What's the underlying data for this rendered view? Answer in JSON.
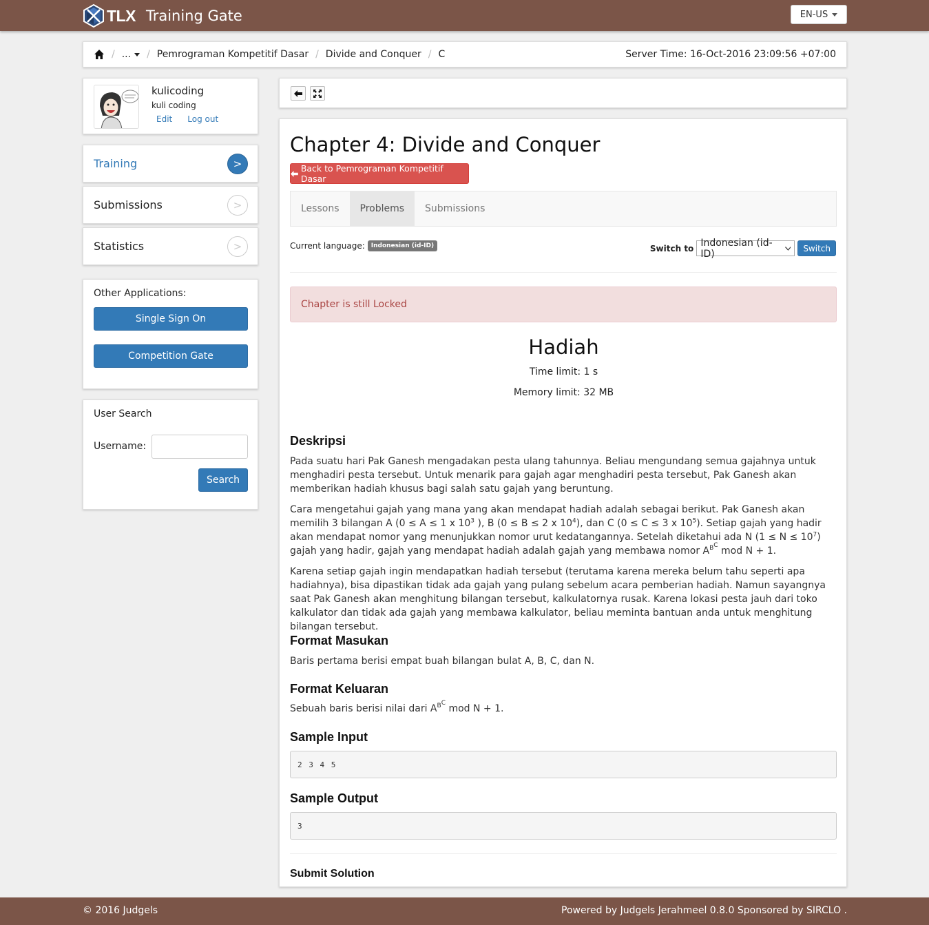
{
  "header": {
    "logo_text": "TLX",
    "app_title": "Training Gate",
    "language": "EN-US"
  },
  "breadcrumb": {
    "items": [
      "...",
      "Pemrograman Kompetitif Dasar",
      "Divide and Conquer",
      "C"
    ],
    "server_time": "Server Time: 16-Oct-2016 23:09:56 +07:00"
  },
  "profile": {
    "username": "kulicoding",
    "name": "kuli coding",
    "edit": "Edit",
    "logout": "Log out"
  },
  "menu": {
    "items": [
      {
        "label": "Training"
      },
      {
        "label": "Submissions"
      },
      {
        "label": "Statistics"
      }
    ],
    "arrow": ">"
  },
  "other_apps": {
    "title": "Other Applications:",
    "sso": "Single Sign On",
    "competition": "Competition Gate"
  },
  "user_search": {
    "title": "User Search",
    "username_label": "Username:",
    "username_value": "",
    "button": "Search"
  },
  "chapter": {
    "title": "Chapter 4: Divide and Conquer",
    "back_button": "Back to Pemrograman Kompetitif Dasar",
    "tabs": [
      "Lessons",
      "Problems",
      "Submissions"
    ],
    "current_language_label": "Current language:",
    "current_language": "Indonesian (id-ID)",
    "switch_label": "Switch to",
    "switch_value": "Indonesian (id-ID)",
    "switch_button": "Switch",
    "alert": "Chapter is still Locked"
  },
  "problem": {
    "title": "Hadiah",
    "time_limit": "Time limit: 1 s",
    "memory_limit": "Memory limit: 32 MB",
    "desc_heading": "Deskripsi",
    "desc_p1": "Pada suatu hari Pak Ganesh mengadakan pesta ulang tahunnya. Beliau mengundang semua gajahnya untuk menghadiri pesta tersebut. Untuk menarik para gajah agar menghadiri pesta tersebut, Pak Ganesh akan memberikan hadiah khusus bagi salah satu gajah yang beruntung.",
    "desc_p3": "Karena setiap gajah ingin mendapatkan hadiah tersebut (terutama karena mereka belum tahu seperti apa hadiahnya), bisa dipastikan tidak ada gajah yang pulang sebelum acara pemberian hadiah. Namun sayangnya saat Pak Ganesh akan menghitung bilangan tersebut, kalkulatornya rusak. Karena lokasi pesta jauh dari toko kalkulator dan tidak ada gajah yang membawa kalkulator, beliau meminta bantuan anda untuk menghitung bilangan tersebut.",
    "input_heading": "Format Masukan",
    "input_text": "Baris pertama berisi empat buah bilangan bulat A, B, C, dan N.",
    "output_heading": "Format Keluaran",
    "sample_input_heading": "Sample Input",
    "sample_input": "2 3 4 5",
    "sample_output_heading": "Sample Output",
    "sample_output": "3",
    "submit_heading": "Submit Solution"
  },
  "footer": {
    "left": "© 2016 Judgels",
    "right": "Powered by Judgels Jerahmeel 0.8.0 Sponsored by SIRCLO ."
  },
  "colors": {
    "brand": "#7b5548",
    "primary": "#337ab7",
    "danger": "#d9534f"
  }
}
